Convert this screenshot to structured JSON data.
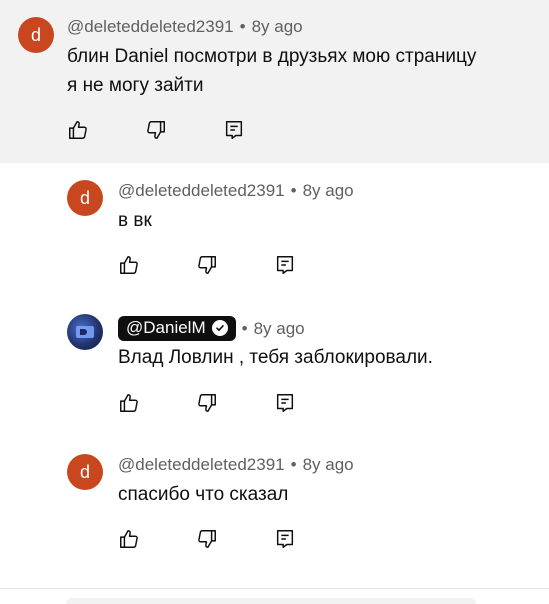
{
  "comments": [
    {
      "handle": "@deleteddeleted2391",
      "time": "8y ago",
      "avatar_letter": "d",
      "lines": [
        "блин Daniel посмотри в друзьях мою страницу",
        "я не могу зайти"
      ]
    },
    {
      "handle": "@deleteddeleted2391",
      "time": "8y ago",
      "avatar_letter": "d",
      "lines": [
        "в вк"
      ]
    },
    {
      "handle": "@DanielM",
      "time": "8y ago",
      "verified": true,
      "lines": [
        "Влад Ловлин , тебя заблокировали."
      ]
    },
    {
      "handle": "@deleteddeleted2391",
      "time": "8y ago",
      "avatar_letter": "d",
      "lines": [
        "спасибо что сказал"
      ]
    }
  ],
  "separator": "•",
  "icons": {
    "like": "thumbs-up-icon",
    "dislike": "thumbs-down-icon",
    "reply": "reply-icon"
  },
  "colors": {
    "avatar_bg": "#c8471f",
    "highlight_bg": "#f2f2f2",
    "meta_text": "#606060"
  }
}
